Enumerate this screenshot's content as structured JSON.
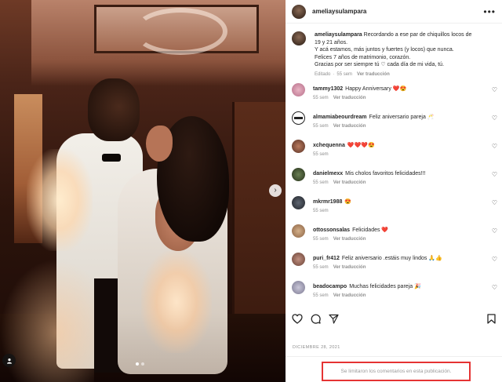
{
  "post": {
    "username": "ameliaysulampara",
    "date": "DICIEMBRE 28, 2021",
    "comments_limited": "Se limitaron los comentarios en esta publicación."
  },
  "caption": {
    "username": "ameliaysulampara",
    "lines": [
      "Recordando a ese par de chiquillos locos de",
      "19 y 21 años.",
      "Y acá estamos, más juntos y fuertes (y locos) que nunca.",
      "Felices 7 años de matrimonio, corazón.",
      "Gracias por ser siempre tú ♡ cada día de mi vida, tú."
    ],
    "edited": "Editado",
    "time": "55 sem",
    "translate": "Ver traducción"
  },
  "comments": [
    {
      "username": "tammy1302",
      "text": "Happy Anniversary ❤️😍",
      "time": "55 sem",
      "translate": "Ver traducción"
    },
    {
      "username": "almamiabeourdream",
      "text": "Feliz aniversario pareja 🥂",
      "time": "55 sem",
      "translate": "Ver traducción"
    },
    {
      "username": "xchequenna",
      "text": "❤️❤️❤️😍",
      "time": "55 sem",
      "translate": ""
    },
    {
      "username": "danielmexx",
      "text": "Mis cholos favoritos felicidades!!!",
      "time": "55 sem",
      "translate": "Ver traducción"
    },
    {
      "username": "mkrmr1988",
      "text": "😍",
      "time": "55 sem",
      "translate": ""
    },
    {
      "username": "ottossonsalas",
      "text": "Felicidades ❤️",
      "time": "55 sem",
      "translate": "Ver traducción"
    },
    {
      "username": "puri_fr412",
      "text": "Feliz aniversario .estáis muy lindos 🙏👍",
      "time": "55 sem",
      "translate": "Ver traducción"
    },
    {
      "username": "beadocampo",
      "text": "Muchas felicidades pareja 🎉",
      "time": "55 sem",
      "translate": "Ver traducción"
    }
  ],
  "icons": {
    "more": "more-options-icon",
    "like": "heart-icon",
    "comment": "comment-icon",
    "share": "paper-plane-icon",
    "save": "bookmark-icon",
    "next": "chevron-right-icon",
    "tag": "user-tag-icon"
  },
  "carousel": {
    "slides": 2,
    "active": 1
  },
  "colors": {
    "highlight": "#e53333",
    "muted": "#8e8e8e",
    "text": "#262626"
  }
}
